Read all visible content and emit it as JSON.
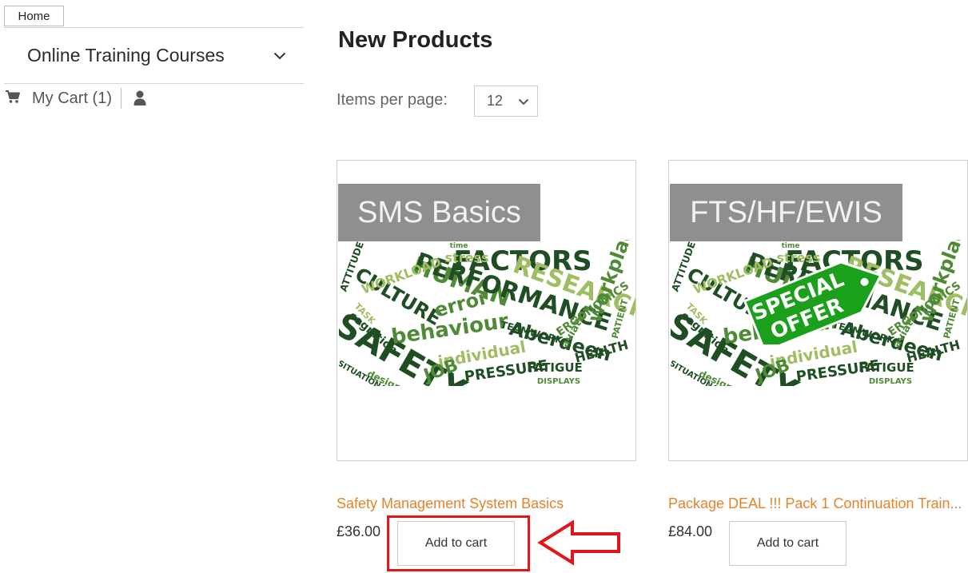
{
  "sidebar": {
    "home_label": "Home",
    "courses_label": "Online Training Courses",
    "cart_label": "My Cart (1)"
  },
  "main": {
    "title": "New Products",
    "items_per_page_label": "Items per page:",
    "items_per_page_value": "12",
    "products": [
      {
        "banner": "SMS Basics",
        "name": "Safety Management System Basics",
        "price": "£36.00",
        "add_label": "Add to cart",
        "special_offer": false
      },
      {
        "banner": "FTS/HF/EWIS",
        "name": "Package DEAL !!! Pack 1 Continuation Train...",
        "price": "£84.00",
        "add_label": "Add to cart",
        "special_offer": true,
        "tag_lines": [
          "SPECIAL",
          "OFFER"
        ]
      }
    ]
  },
  "wordcloud_words": [
    "HUMAN",
    "FACTORS",
    "PERFORMANCE",
    "SAFETY",
    "RESEARCH",
    "workplace",
    "behaviour",
    "Aberdeen",
    "CULTURE",
    "error",
    "individual",
    "JOB",
    "PRESSURE",
    "FATIGUE",
    "design",
    "cognition",
    "ERGONOMICS",
    "WORKLOAD",
    "HEALTH",
    "aviation",
    "stress",
    "time",
    "TEAMWORK",
    "PATIENT",
    "SITUATIONAL",
    "ATTITUDE",
    "DISPLAYS",
    "TASK",
    "controls",
    "LIMITATIONS"
  ],
  "colors": {
    "accent_orange": "#e8822a",
    "banner_gray": "#8f8f8f",
    "annotation_red": "#e0161b",
    "tag_green": "#1aa01a",
    "wc_dark": "#1f4d24",
    "wc_mid": "#4f8a36",
    "wc_light": "#9fbd62"
  }
}
